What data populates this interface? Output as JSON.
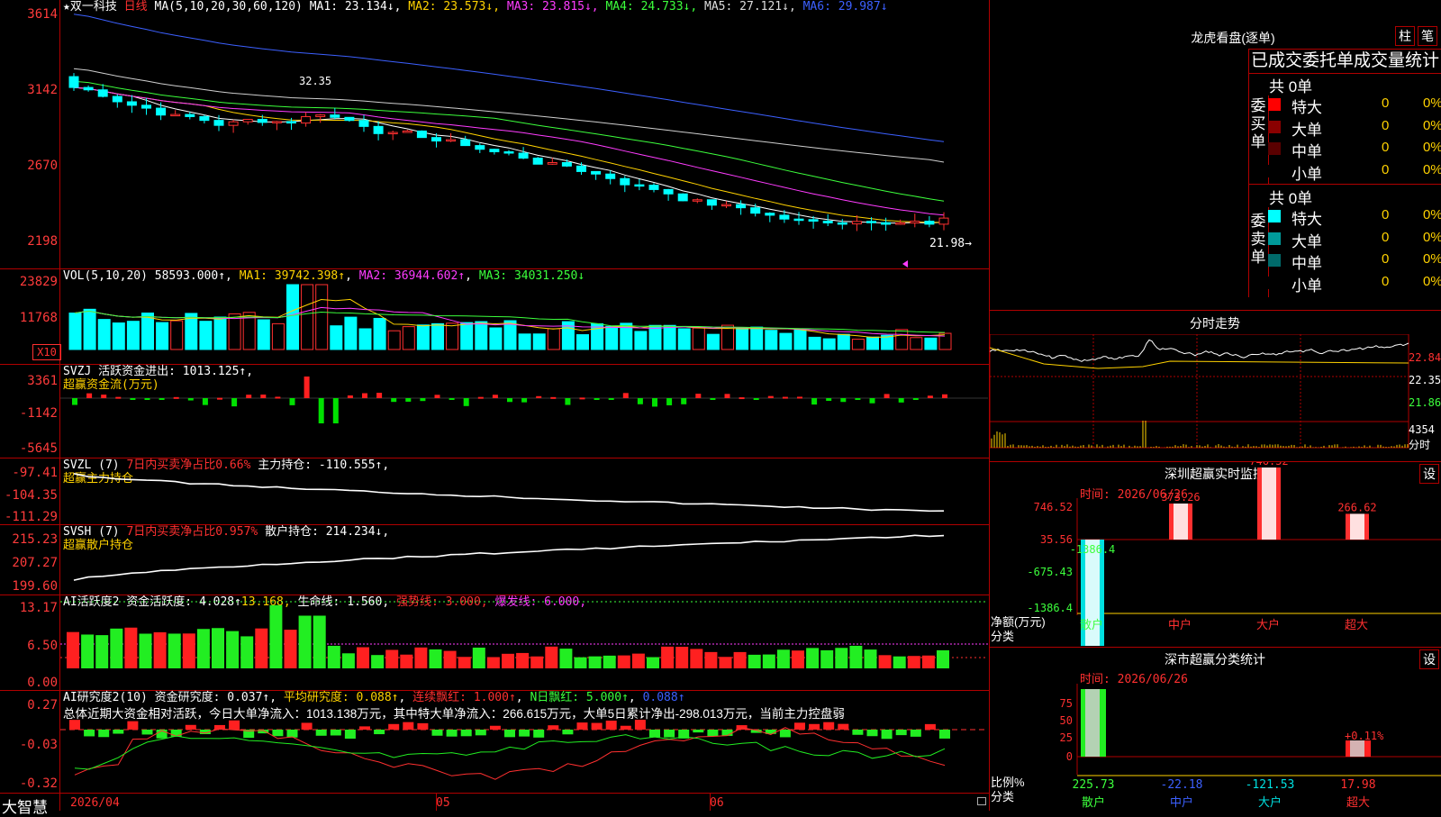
{
  "app": {
    "name": "大智慧"
  },
  "stock": {
    "star": "★",
    "name": "双一科技",
    "period": "日线"
  },
  "price_panel": {
    "indicator": "MA(5,10,20,30,60,120)",
    "ma": [
      {
        "label": "MA1: 23.134↓",
        "color": "#ffffff"
      },
      {
        "label": "MA2: 23.573↓",
        "color": "#ffd200"
      },
      {
        "label": "MA3: 23.815↓",
        "color": "#ff3cff"
      },
      {
        "label": "MA4: 24.733↓",
        "color": "#3cff3c"
      },
      {
        "label": "MA5: 27.121↓",
        "color": "#dddddd"
      },
      {
        "label": "MA6: 29.987↓",
        "color": "#3c60ff"
      }
    ],
    "y_labels": [
      "3614",
      "3142",
      "2670",
      "2198"
    ],
    "high_label": "32.35",
    "low_label": "21.98→"
  },
  "vol_panel": {
    "title": "VOL(5,10,20)",
    "value": "58593.000↑",
    "ma1": "MA1: 39742.398↑",
    "ma2": "MA2: 36944.602↑",
    "ma3": "MA3: 34031.250↓",
    "y_labels": [
      "23829",
      "11768"
    ],
    "unit": "X10"
  },
  "svzj_panel": {
    "line1": "SVZJ  活跃资金进出: 1013.125↑,",
    "line2": "超赢资金流(万元)",
    "y_labels": [
      "3361",
      "-1142",
      "-5645"
    ]
  },
  "svzl_panel": {
    "prefix": "SVZL (7)",
    "ratio": "7日内买卖净占比0.66%",
    "pos": "主力持仓: -110.555↑,",
    "line2": "超赢主力持仓",
    "y_labels": [
      "-97.41",
      "-104.35",
      "-111.29"
    ]
  },
  "svsh_panel": {
    "prefix": "SVSH (7)",
    "ratio": "7日内买卖净占比0.957%",
    "pos": "散户持仓: 214.234↓,",
    "line2": "超赢散户持仓",
    "y_labels": [
      "215.23",
      "207.27",
      "199.60"
    ]
  },
  "ai_act_panel": {
    "title": "AI活跃度2 资金活跃度: 4.028↑",
    "v2": "13.168,",
    "life": "生命线: 1.560,",
    "strong": "强势线: 3.000,",
    "burst": "爆发线: 6.000,",
    "y_labels": [
      "13.17",
      "6.50",
      "0.00"
    ]
  },
  "ai_res_panel": {
    "title": "AI研究度2(10) 资金研究度: 0.037↑",
    "avg": "平均研究度: 0.088↑",
    "red1": "连续飘红: 1.000↑",
    "red2": "N日飘红: 5.000↑",
    "v5": "0.088↑",
    "summary": "总体近期大资金相对活跃，今日大单净流入：1013.138万元，其中特大单净流入：266.615万元，大单5日累计净出-298.013万元，当前主力控盘弱",
    "y_labels": [
      "0.27",
      "-0.03",
      "-0.32"
    ]
  },
  "x_axis": {
    "labels": [
      "2026/04",
      "05",
      "06"
    ]
  },
  "right_panel": {
    "tab_title": "龙虎看盘(逐单)",
    "btn_bar": "柱",
    "btn_pen": "笔",
    "stats_title": "已成交委托单成交量统计",
    "buy": {
      "header": "共 0单",
      "side": "委买单",
      "rows": [
        {
          "label": "特大",
          "value": "0",
          "pct": "0%",
          "color": "#ff0000"
        },
        {
          "label": "大单",
          "value": "0",
          "pct": "0%",
          "color": "#8a0000"
        },
        {
          "label": "中单",
          "value": "0",
          "pct": "0%",
          "color": "#5a0000"
        },
        {
          "label": "小单",
          "value": "0",
          "pct": "0%",
          "color": "#000000"
        }
      ]
    },
    "sell": {
      "header": "共 0单",
      "side": "委卖单",
      "rows": [
        {
          "label": "特大",
          "value": "0",
          "pct": "0%",
          "color": "#00ffff"
        },
        {
          "label": "大单",
          "value": "0",
          "pct": "0%",
          "color": "#009a9a"
        },
        {
          "label": "中单",
          "value": "0",
          "pct": "0%",
          "color": "#006a6a"
        },
        {
          "label": "小单",
          "value": "0",
          "pct": "0%",
          "color": "#000000"
        }
      ]
    },
    "intraday": {
      "title": "分时走势",
      "p1": "22.84",
      "p2": "22.35",
      "p3": "21.86",
      "vol": "4354",
      "vol_unit": "分时"
    },
    "monitor": {
      "title": "深圳超赢实时监控",
      "btn": "设",
      "time": "时间: 2026/06/26",
      "y_labels": [
        "746.52",
        "35.56",
        "-675.43",
        "-1386.4"
      ],
      "net_label": "净额(万元)",
      "cat_label": "分类",
      "categories": [
        "散户",
        "中户",
        "大户",
        "超大"
      ]
    },
    "classify": {
      "title": "深市超赢分类统计",
      "btn": "设",
      "time": "时间: 2026/06/26",
      "y_labels": [
        "75",
        "50",
        "25",
        "0"
      ],
      "ratio_label": "比例%",
      "cat_label": "分类",
      "categories": [
        "散户",
        "中户",
        "大户",
        "超大"
      ]
    }
  },
  "chart_data": [
    {
      "type": "bar",
      "title": "深圳超赢实时监控",
      "ylabel": "净额(万元)",
      "categories": [
        "散户",
        "中户",
        "大户",
        "超大"
      ],
      "values": [
        -1386.4,
        373.26,
        746.52,
        266.62
      ],
      "ylim": [
        -1386.4,
        746.52
      ]
    },
    {
      "type": "bar",
      "title": "深市超赢分类统计",
      "ylabel": "比例%",
      "categories": [
        "散户",
        "中户",
        "大户",
        "超大"
      ],
      "values": [
        225.73,
        -22.18,
        -121.53,
        17.98
      ],
      "annotations": [
        "+0.11%"
      ],
      "ylim": [
        0,
        75
      ]
    }
  ]
}
